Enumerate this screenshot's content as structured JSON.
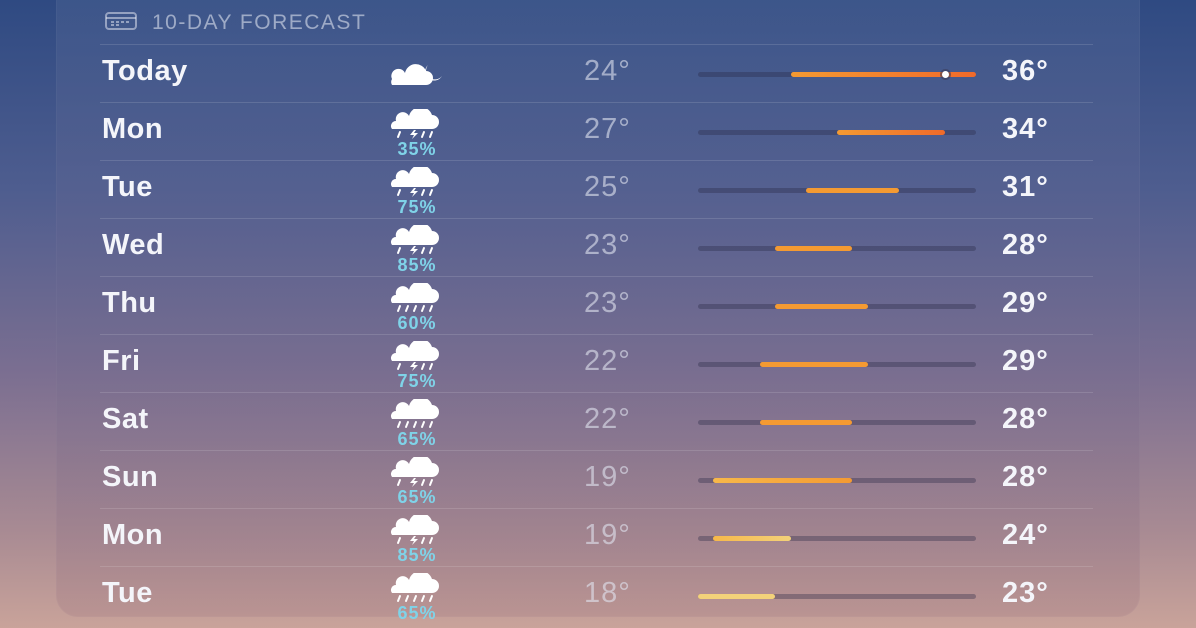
{
  "header": {
    "title": "10-DAY FORECAST",
    "icon": "calendar-icon"
  },
  "scale": {
    "min": 18,
    "max": 36
  },
  "current_temp": 34,
  "days": [
    {
      "day": "Today",
      "icon": "cloud-moon-icon",
      "precip": "",
      "low": "24°",
      "high": "36°",
      "low_val": 24,
      "high_val": 36
    },
    {
      "day": "Mon",
      "icon": "cloud-bolt-rain-icon",
      "precip": "35%",
      "low": "27°",
      "high": "34°",
      "low_val": 27,
      "high_val": 34
    },
    {
      "day": "Tue",
      "icon": "cloud-bolt-rain-icon",
      "precip": "75%",
      "low": "25°",
      "high": "31°",
      "low_val": 25,
      "high_val": 31
    },
    {
      "day": "Wed",
      "icon": "cloud-bolt-rain-icon",
      "precip": "85%",
      "low": "23°",
      "high": "28°",
      "low_val": 23,
      "high_val": 28
    },
    {
      "day": "Thu",
      "icon": "cloud-rain-icon",
      "precip": "60%",
      "low": "23°",
      "high": "29°",
      "low_val": 23,
      "high_val": 29
    },
    {
      "day": "Fri",
      "icon": "cloud-bolt-rain-icon",
      "precip": "75%",
      "low": "22°",
      "high": "29°",
      "low_val": 22,
      "high_val": 29
    },
    {
      "day": "Sat",
      "icon": "cloud-rain-icon",
      "precip": "65%",
      "low": "22°",
      "high": "28°",
      "low_val": 22,
      "high_val": 28
    },
    {
      "day": "Sun",
      "icon": "cloud-bolt-rain-icon",
      "precip": "65%",
      "low": "19°",
      "high": "28°",
      "low_val": 19,
      "high_val": 28
    },
    {
      "day": "Mon",
      "icon": "cloud-bolt-rain-icon",
      "precip": "85%",
      "low": "19°",
      "high": "24°",
      "low_val": 19,
      "high_val": 24
    },
    {
      "day": "Tue",
      "icon": "cloud-rain-icon",
      "precip": "65%",
      "low": "18°",
      "high": "23°",
      "low_val": 18,
      "high_val": 23
    }
  ],
  "colors": {
    "precip": "#7fd3e8",
    "hot": "#f06a2a",
    "warm": "#f49a32",
    "mild": "#f7b84a",
    "cool": "#f3d27a"
  }
}
